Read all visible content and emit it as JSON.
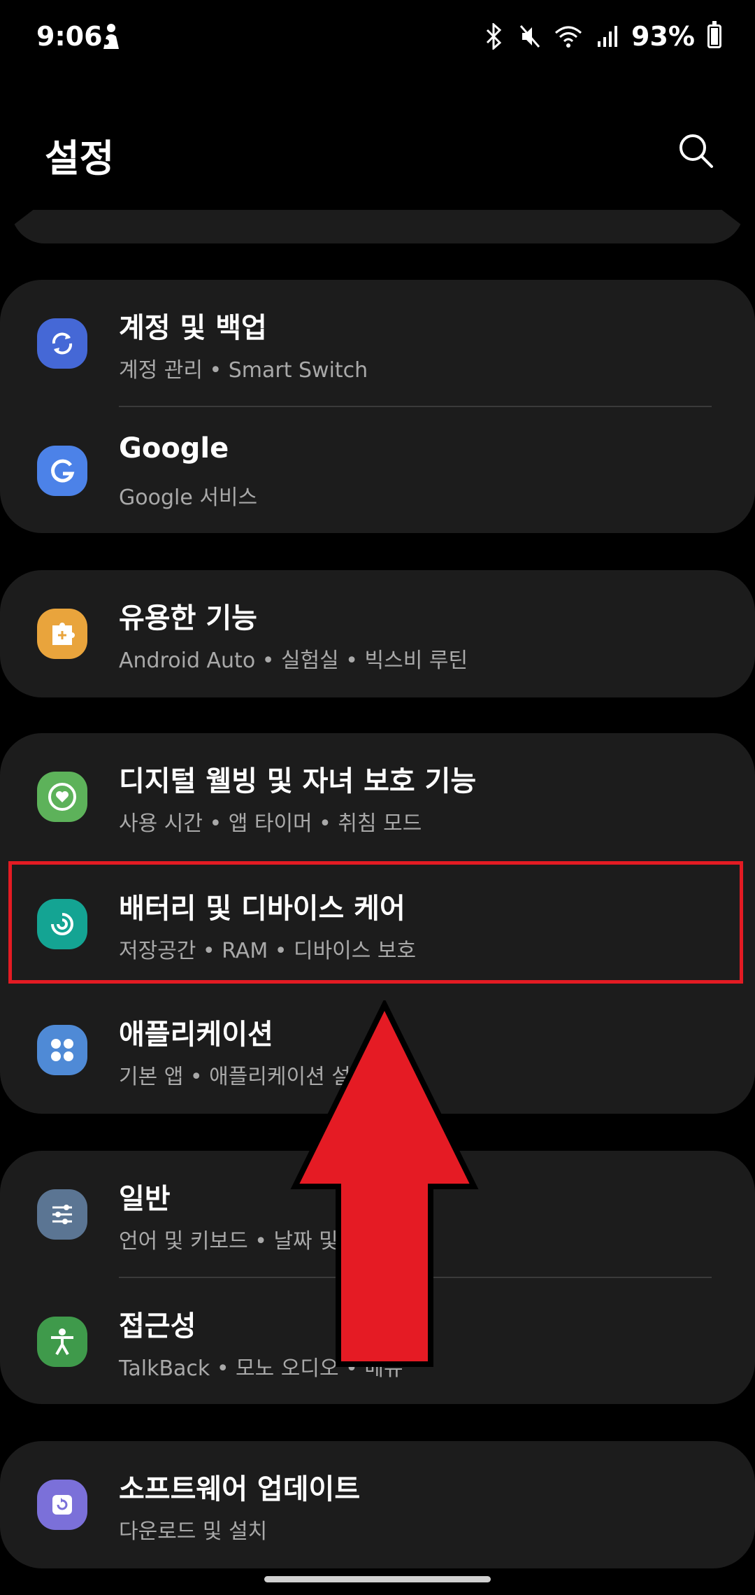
{
  "status_bar": {
    "time": "9:06",
    "battery": "93%"
  },
  "header": {
    "title": "설정"
  },
  "groups": [
    {
      "items": [
        {
          "title": "계정 및 백업",
          "subtitle": "계정 관리 • Smart Switch",
          "icon": "sync-icon",
          "color": "#4568d6"
        },
        {
          "title": "Google",
          "subtitle": "Google 서비스",
          "icon": "google-g-icon",
          "color": "#4c82e8"
        }
      ]
    },
    {
      "items": [
        {
          "title": "유용한 기능",
          "subtitle": "Android Auto • 실험실 • 빅스비 루틴",
          "icon": "puzzle-plus-icon",
          "color": "#e9a43c"
        }
      ]
    },
    {
      "items": [
        {
          "title": "디지털 웰빙 및 자녀 보호 기능",
          "subtitle": "사용 시간 • 앱 타이머 • 취침 모드",
          "icon": "heart-circle-icon",
          "color": "#5db25a"
        },
        {
          "title": "배터리 및 디바이스 케어",
          "subtitle": "저장공간 • RAM • 디바이스 보호",
          "icon": "device-care-icon",
          "color": "#14a493"
        },
        {
          "title": "애플리케이션",
          "subtitle": "기본 앱 • 애플리케이션 설정",
          "icon": "apps-grid-icon",
          "color": "#4f8ad6"
        }
      ]
    },
    {
      "items": [
        {
          "title": "일반",
          "subtitle": "언어 및 키보드 • 날짜 및 시간",
          "icon": "sliders-icon",
          "color": "#5b7593"
        },
        {
          "title": "접근성",
          "subtitle": "TalkBack • 모노 오디오 • 메뉴",
          "icon": "accessibility-icon",
          "color": "#3f9a4b"
        }
      ]
    },
    {
      "items": [
        {
          "title": "소프트웨어 업데이트",
          "subtitle": "다운로드 및 설치",
          "icon": "update-icon",
          "color": "#7b70d9"
        }
      ]
    }
  ],
  "annotation": {
    "highlight_color": "#e31b23",
    "arrow_color": "#e51b24"
  }
}
